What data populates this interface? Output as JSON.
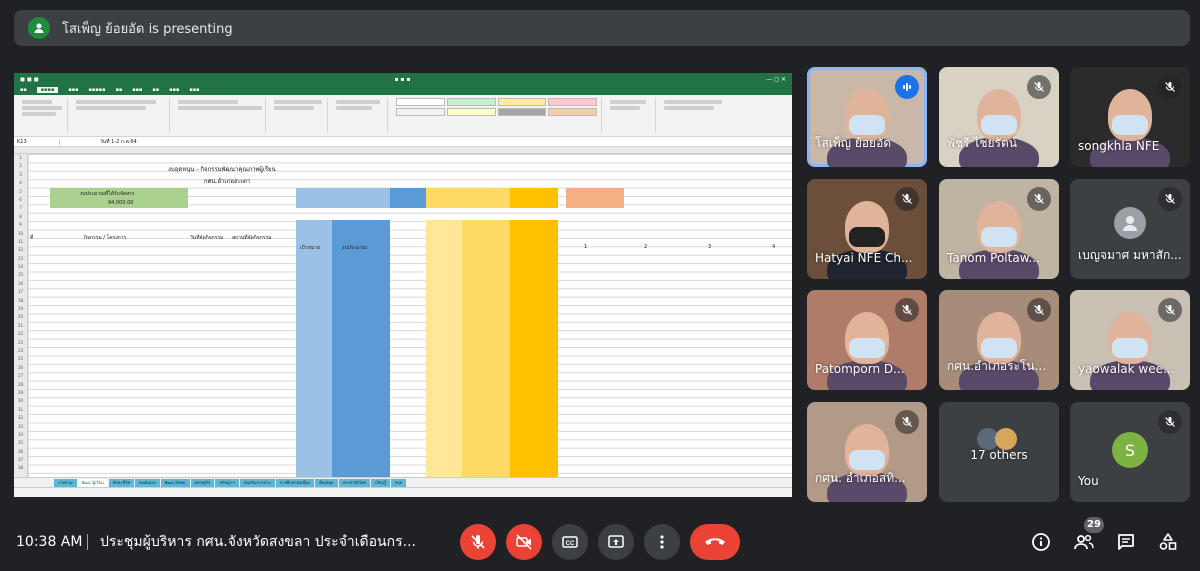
{
  "banner": {
    "text": "โสเพ็ญ ย้อยอัด is presenting"
  },
  "shared_screen": {
    "formula_cell": "K13",
    "formula_text": "วันที่ 1-2 ก.ค.64",
    "sheet_title": "งบอุดหนุน - กิจกรรมพัฒนาคุณภาพผู้เรียน",
    "sheet_subtitle": "กศน.อำเภอสะเดา",
    "budget_label": "งบประมาณที่ได้รับจัดสรร",
    "budget_value": "94,000.00",
    "headers": [
      "ที่",
      "กิจกรรม / โครงการ",
      "วันที่จัดกิจกรรม",
      "สถานที่จัดกิจกรรม",
      "เป้าหมาย",
      "งบประมาณ"
    ],
    "col_numbers": [
      "1",
      "2",
      "3",
      "4"
    ],
    "sheet_tabs": [
      "ภาพรวม",
      "พัฒนาผู้เรียน",
      "ทักษะชีวิต",
      "คนตันเอง",
      "พัฒนาสังคม",
      "เศรษฐกิจ",
      "ปรัชญาฯ",
      "ส่งเสริมการอ่าน",
      "การศึกษาต่อเนื่อง",
      "ห้องสมุด",
      "ประชาธิปไตย",
      "เรียนรู้",
      "สรุป"
    ]
  },
  "participants": [
    {
      "name": "โสเพ็ญ ย้อยอัด",
      "speaking": true,
      "muted": false
    },
    {
      "name": "พัชรี ไชยรัตน์",
      "speaking": false,
      "muted": true
    },
    {
      "name": "songkhla NFE",
      "speaking": false,
      "muted": true
    },
    {
      "name": "Hatyai NFE Ch...",
      "speaking": false,
      "muted": true
    },
    {
      "name": "Tanom Poltaw...",
      "speaking": false,
      "muted": true
    },
    {
      "name": "เบญจมาศ มหาสัก...",
      "speaking": false,
      "muted": true
    },
    {
      "name": "Patomporn D...",
      "speaking": false,
      "muted": true
    },
    {
      "name": "กศน.อำเภอระโน...",
      "speaking": false,
      "muted": true
    },
    {
      "name": "yaowalak wee...",
      "speaking": false,
      "muted": true
    },
    {
      "name": "กศน. อำเภอสทิ...",
      "speaking": false,
      "muted": true
    },
    {
      "name": "17 others",
      "speaking": false,
      "muted": false
    },
    {
      "name": "You",
      "speaking": false,
      "muted": true,
      "initial": "S"
    }
  ],
  "meeting": {
    "time": "10:38 AM",
    "title": "ประชุมผู้บริหาร กศน.จังหวัดสงขลา ประจำเดือนกร...",
    "participant_count": "29"
  },
  "colors": {
    "accent_red": "#ea4335",
    "bar_bg": "#202124",
    "tile_bg": "#3c4043",
    "speaking": "#8ab4f8",
    "excel_green": "#217346"
  }
}
